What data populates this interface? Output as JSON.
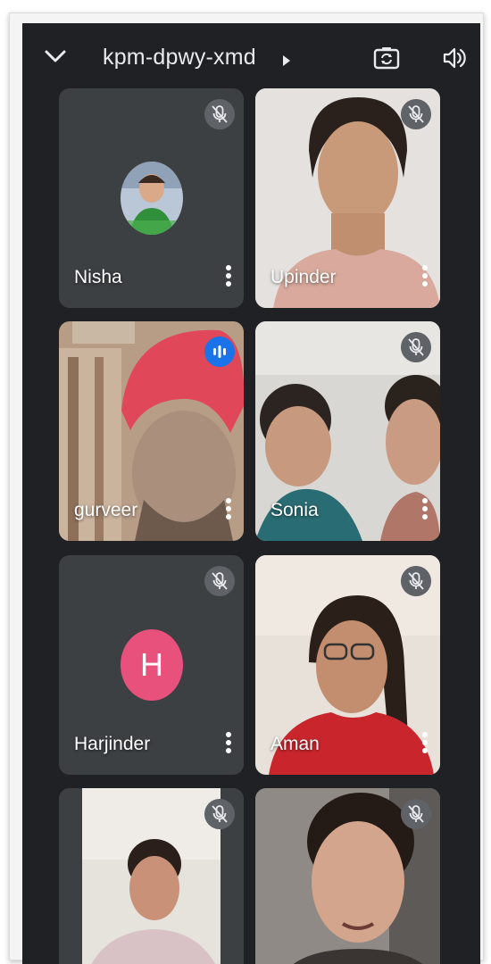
{
  "meeting": {
    "code": "kpm-dpwy-xmd"
  },
  "icons": {
    "back": "chevron-down-icon",
    "details": "caret-right-icon",
    "camera": "camera-switch-icon",
    "audio": "speaker-icon",
    "muted": "mic-off-icon",
    "speaking": "audio-level-icon",
    "options": "more-vert-icon"
  },
  "colors": {
    "background": "#202124",
    "tile": "#3c4043",
    "avatar_h": "#e8517b",
    "speaking": "#1a73e8"
  },
  "participants": [
    {
      "name": "Nisha",
      "muted": true,
      "video": false,
      "avatar": "photo"
    },
    {
      "name": "Upinder",
      "muted": true,
      "video": true
    },
    {
      "name": "gurveer",
      "muted": false,
      "speaking": true,
      "video": true
    },
    {
      "name": "Sonia",
      "muted": true,
      "video": true
    },
    {
      "name": "Harjinder",
      "muted": true,
      "video": false,
      "avatar_letter": "H"
    },
    {
      "name": "Aman",
      "muted": true,
      "video": true
    },
    {
      "name": "",
      "muted": true,
      "video": true
    },
    {
      "name": "",
      "muted": true,
      "video": true
    }
  ]
}
